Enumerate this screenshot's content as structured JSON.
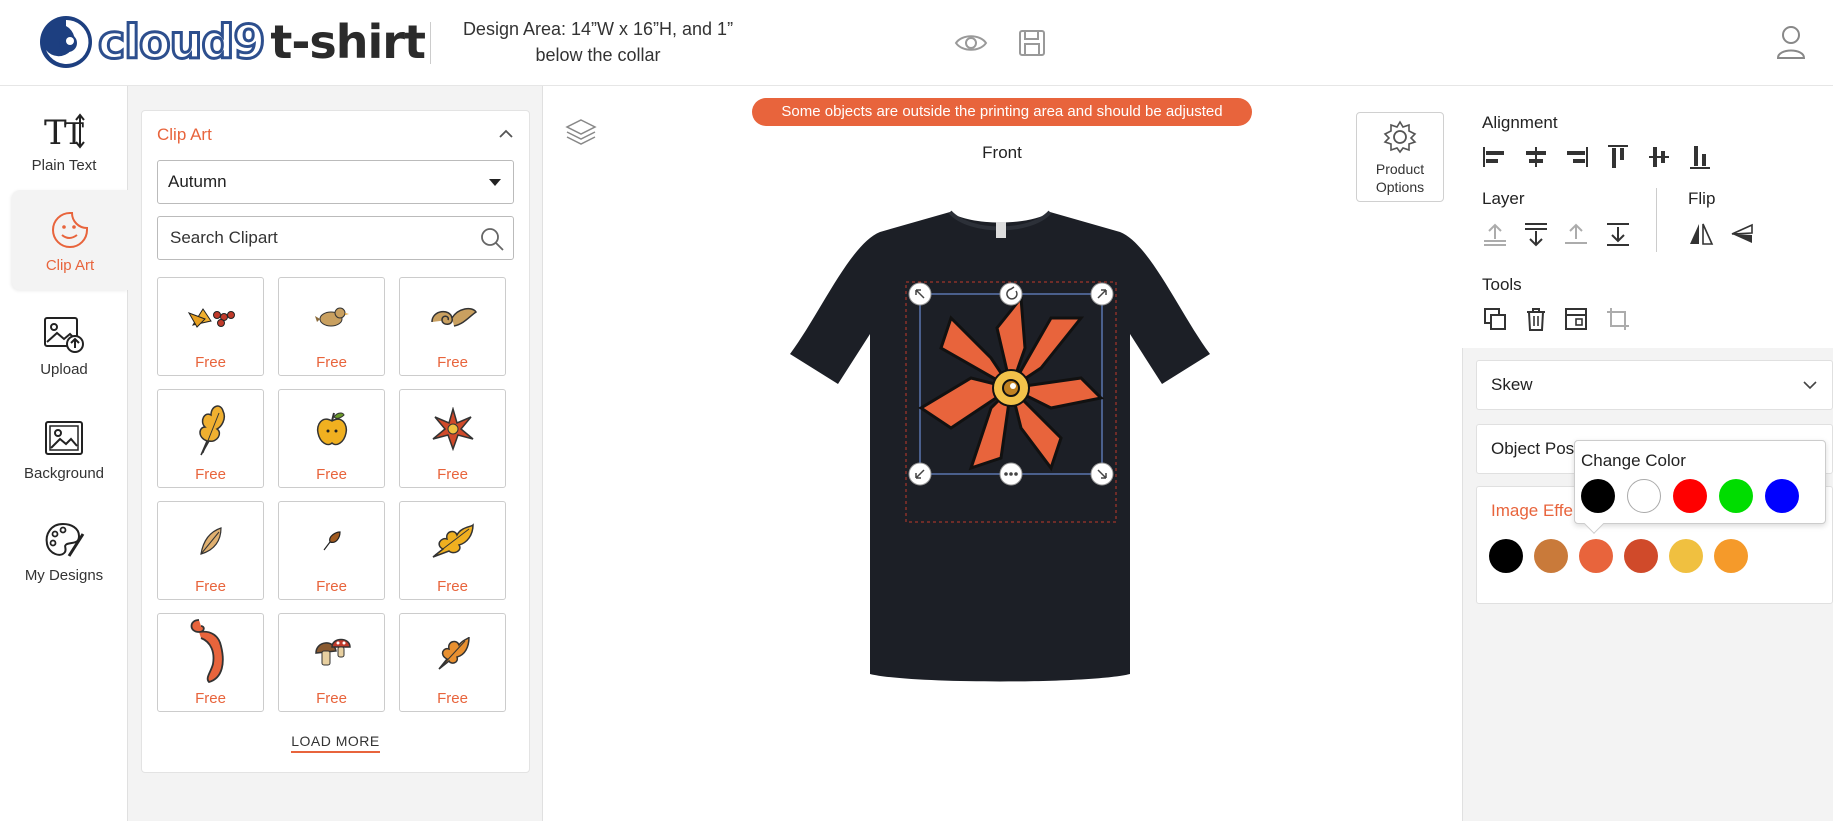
{
  "header": {
    "logo_main": "cloud9",
    "logo_sub": "t-shirt",
    "design_area": "Design Area: 14”W x 16”H, and 1” below the collar",
    "icons": [
      "eye-icon",
      "save-icon",
      "user-icon"
    ]
  },
  "nav": {
    "items": [
      {
        "label": "Plain Text",
        "icon": "text-icon"
      },
      {
        "label": "Clip Art",
        "icon": "clipart-icon",
        "active": true
      },
      {
        "label": "Upload",
        "icon": "upload-icon"
      },
      {
        "label": "Background",
        "icon": "image-icon"
      },
      {
        "label": "My Designs",
        "icon": "palette-icon"
      }
    ]
  },
  "clipart": {
    "title": "Clip Art",
    "category": "Autumn",
    "search_placeholder": "Search Clipart",
    "tiles": [
      {
        "price": "Free",
        "art": "berries"
      },
      {
        "price": "Free",
        "art": "bird"
      },
      {
        "price": "Free",
        "art": "swirl"
      },
      {
        "price": "Free",
        "art": "oak-leaf"
      },
      {
        "price": "Free",
        "art": "apple"
      },
      {
        "price": "Free",
        "art": "star-flower"
      },
      {
        "price": "Free",
        "art": "small-leaf"
      },
      {
        "price": "Free",
        "art": "tiny-leaf"
      },
      {
        "price": "Free",
        "art": "yellow-leaf"
      },
      {
        "price": "Free",
        "art": "curl"
      },
      {
        "price": "Free",
        "art": "mushroom"
      },
      {
        "price": "Free",
        "art": "orange-leaf"
      }
    ],
    "load_more": "LOAD MORE"
  },
  "canvas": {
    "warning": "Some objects are outside the printing area and should be adjusted",
    "side": "Front",
    "product_options": "Product Options"
  },
  "right": {
    "alignment": "Alignment",
    "layer": "Layer",
    "flip": "Flip",
    "tools": "Tools",
    "skew": "Skew",
    "object_position": "Object Pos",
    "image_effects": "Image Effe",
    "change_color": "Change Color",
    "popup_colors": [
      "#000000",
      "#ffffff",
      "#ff0000",
      "#00dd00",
      "#0000ff"
    ],
    "effect_colors": [
      "#000000",
      "#c97a3a",
      "#e8643c",
      "#d04a2a",
      "#f0c040",
      "#f59a2a"
    ]
  },
  "colors": {
    "accent": "#e8643c",
    "shirt": "#1c1f26"
  }
}
